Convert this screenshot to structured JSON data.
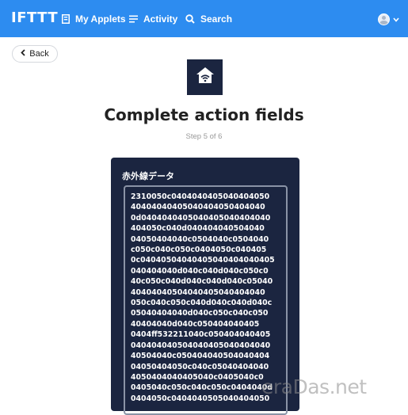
{
  "header": {
    "logo": "IFTTT",
    "nav": [
      {
        "label": "My Applets",
        "icon": "applets-icon"
      },
      {
        "label": "Activity",
        "icon": "activity-icon"
      },
      {
        "label": "Search",
        "icon": "search-icon"
      }
    ],
    "avatar_icon": "avatar-icon",
    "menu_icon": "chevron-down-icon"
  },
  "back": {
    "label": "Back"
  },
  "service": {
    "icon": "home-wifi-icon"
  },
  "title": "Complete action fields",
  "step": "Step 5 of 6",
  "field": {
    "label": "赤外線データ",
    "value_lines": [
      "2310050c0404040405040404050",
      "40404040405040404050404040",
      "0d0404040405040405040404040",
      "404050c040d040404040504040",
      "04050404040c0504040c0504040",
      "c050c040c050c0404050c040405",
      "0c04040504040405040404040405",
      "040404040d040c040d040c050c0",
      "40c050c040d040c040d040c05040",
      "40404040504040405040404040",
      "050c040c050c040d040c040d040c",
      "05040404040d040c050c040c050",
      "40404040d040c050404040405",
      "0404ff532211040c050404040405",
      "040404040504040405040404040",
      "40504040c050404040504040404",
      "04050404050c040c05040404040",
      "4050404040405040c0405040c0",
      "0405040c050c040c050c0404040d",
      "0404050c0404040505040404050"
    ]
  },
  "watermark": "eraDas.net",
  "colors": {
    "header_bg": "#2d8cf0",
    "panel_bg": "#1b2540",
    "accent": "#ffffff"
  }
}
